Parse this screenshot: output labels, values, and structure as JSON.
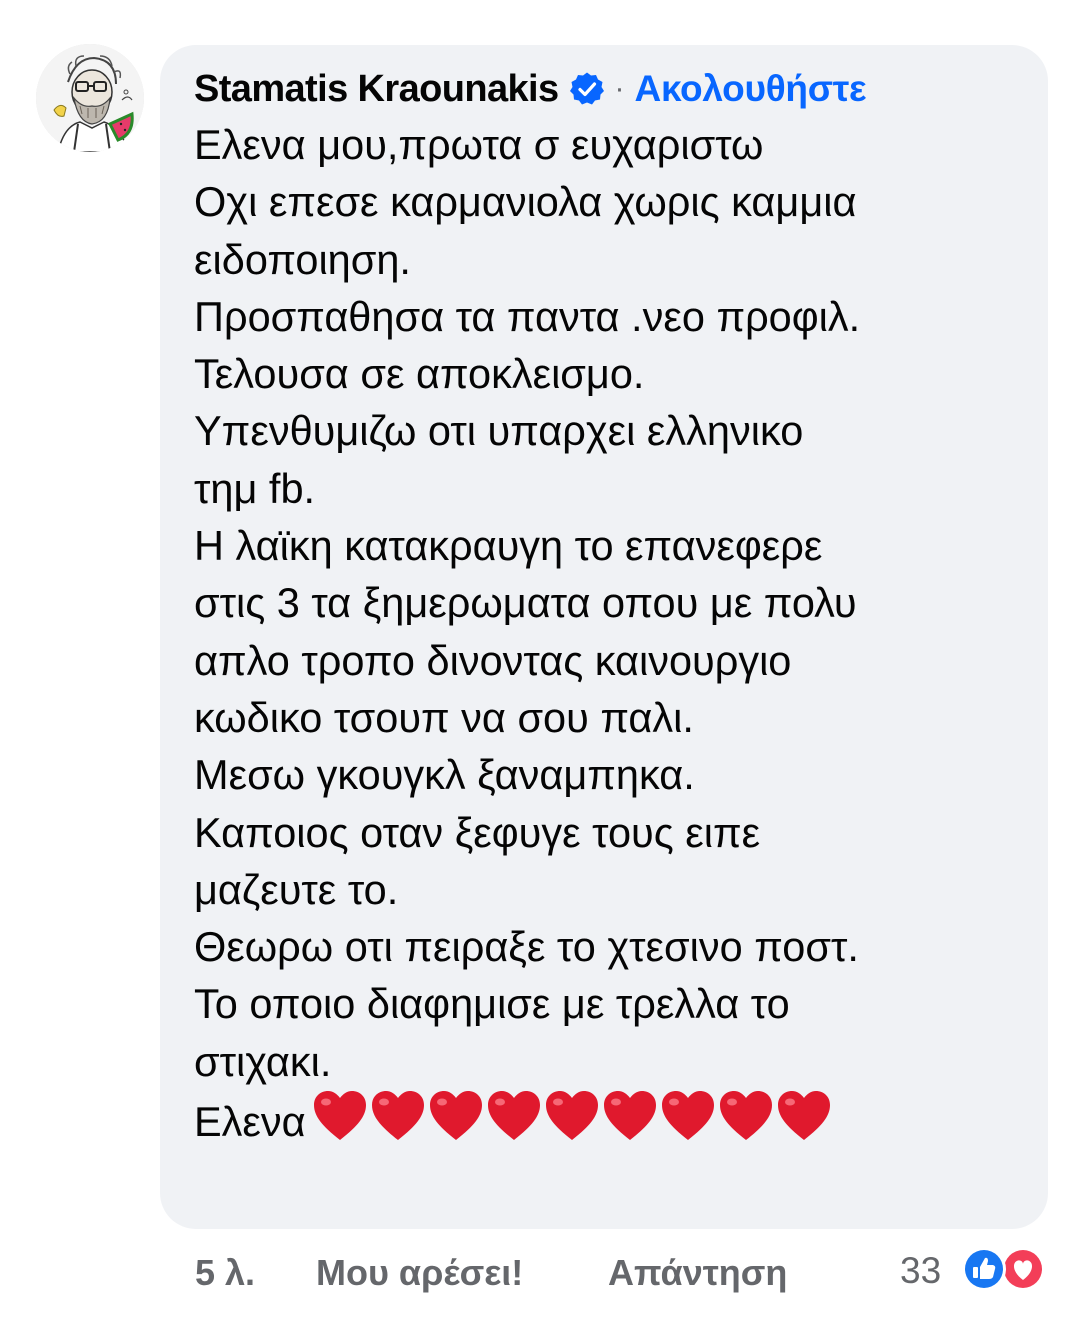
{
  "comment": {
    "author": "Stamatis Kraounakis",
    "verified_icon": "verified-badge-icon",
    "separator": "·",
    "follow_label": "Ακολουθήστε",
    "lines": [
      "Ελενα μου,πρωτα σ ευχαριστω",
      "Οχι επεσε καρμανιολα χωρις καμμια",
      "ειδοποιηση.",
      "Προσπαθησα τα παντα .νεο προφιλ.",
      "Τελουσα σε αποκλεισμο.",
      "Υπενθυμιζω οτι υπαρχει ελληνικο",
      "τημ fb.",
      "Η λαϊκη κατακραυγη το επανεφερε",
      "στις 3 τα ξημερωματα οπου με πολυ",
      "απλο τροπο δινοντας καινουργιο",
      "κωδικο τσουπ να σου παλι.",
      "Μεσω γκουγκλ ξαναμπηκα.",
      "Καποιος οταν ξεφυγε τους ειπε",
      "μαζευτε το.",
      "Θεωρω οτι πειραξε το χτεσινο ποστ.",
      "Το οποιο διαφημισε με τρελλα το",
      "στιχακι.",
      "Ελενα"
    ],
    "hearts_count": 9,
    "heart_icon": "red-heart-emoji-icon"
  },
  "footer": {
    "time": "5 λ.",
    "like_label": "Μου αρέσει!",
    "reply_label": "Απάντηση",
    "reactions_count": "33",
    "reaction_icons": [
      "like-reaction-icon",
      "love-reaction-icon"
    ]
  },
  "colors": {
    "bubble": "#f0f2f5",
    "follow_link": "#0866ff",
    "secondary_text": "#65676b",
    "verified_badge": "#0866ff",
    "heart": "#e0192d"
  }
}
